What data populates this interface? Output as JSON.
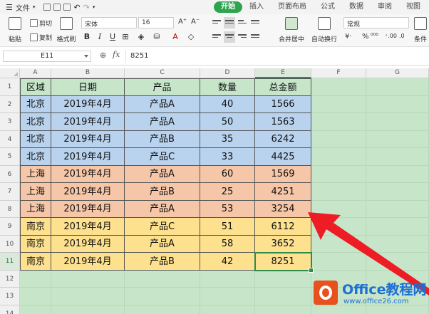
{
  "menubar": {
    "file_label": "文件",
    "tabs": [
      "开始",
      "插入",
      "页面布局",
      "公式",
      "数据",
      "审阅",
      "视图"
    ],
    "active_tab": "开始"
  },
  "ribbon": {
    "paste": "粘贴",
    "cut": "剪切",
    "copy": "复制",
    "format_painter": "格式刷",
    "font_name": "宋体",
    "font_size": "16",
    "merge_center": "合并居中",
    "wrap_text": "自动换行",
    "number_format": "常规",
    "conditional": "条件"
  },
  "formula_bar": {
    "cell_ref": "E11",
    "fx": "fx",
    "value": "8251"
  },
  "columns": [
    "A",
    "B",
    "C",
    "D",
    "E",
    "F",
    "G"
  ],
  "rows": [
    "1",
    "2",
    "3",
    "4",
    "5",
    "6",
    "7",
    "8",
    "9",
    "10",
    "11",
    "12",
    "13",
    "14"
  ],
  "table": {
    "headers": [
      "区域",
      "日期",
      "产品",
      "数量",
      "总金额"
    ],
    "rows": [
      [
        "北京",
        "2019年4月",
        "产品A",
        "40",
        "1566"
      ],
      [
        "北京",
        "2019年4月",
        "产品A",
        "50",
        "1563"
      ],
      [
        "北京",
        "2019年4月",
        "产品B",
        "35",
        "6242"
      ],
      [
        "北京",
        "2019年4月",
        "产品C",
        "33",
        "4425"
      ],
      [
        "上海",
        "2019年4月",
        "产品A",
        "60",
        "1569"
      ],
      [
        "上海",
        "2019年4月",
        "产品B",
        "25",
        "4251"
      ],
      [
        "上海",
        "2019年4月",
        "产品A",
        "53",
        "3254"
      ],
      [
        "南京",
        "2019年4月",
        "产品C",
        "51",
        "6112"
      ],
      [
        "南京",
        "2019年4月",
        "产品A",
        "58",
        "3652"
      ],
      [
        "南京",
        "2019年4月",
        "产品B",
        "42",
        "8251"
      ]
    ]
  },
  "colors": {
    "header_fill": "#c6e5c9",
    "beijing_fill": "#b9d3ee",
    "shanghai_fill": "#f6c6a8",
    "nanjing_fill": "#fde18f",
    "selection": "#2e8b4a",
    "arrow": "#ee1c25"
  },
  "watermark": {
    "title": "Office教程网",
    "url": "www.office26.com"
  }
}
